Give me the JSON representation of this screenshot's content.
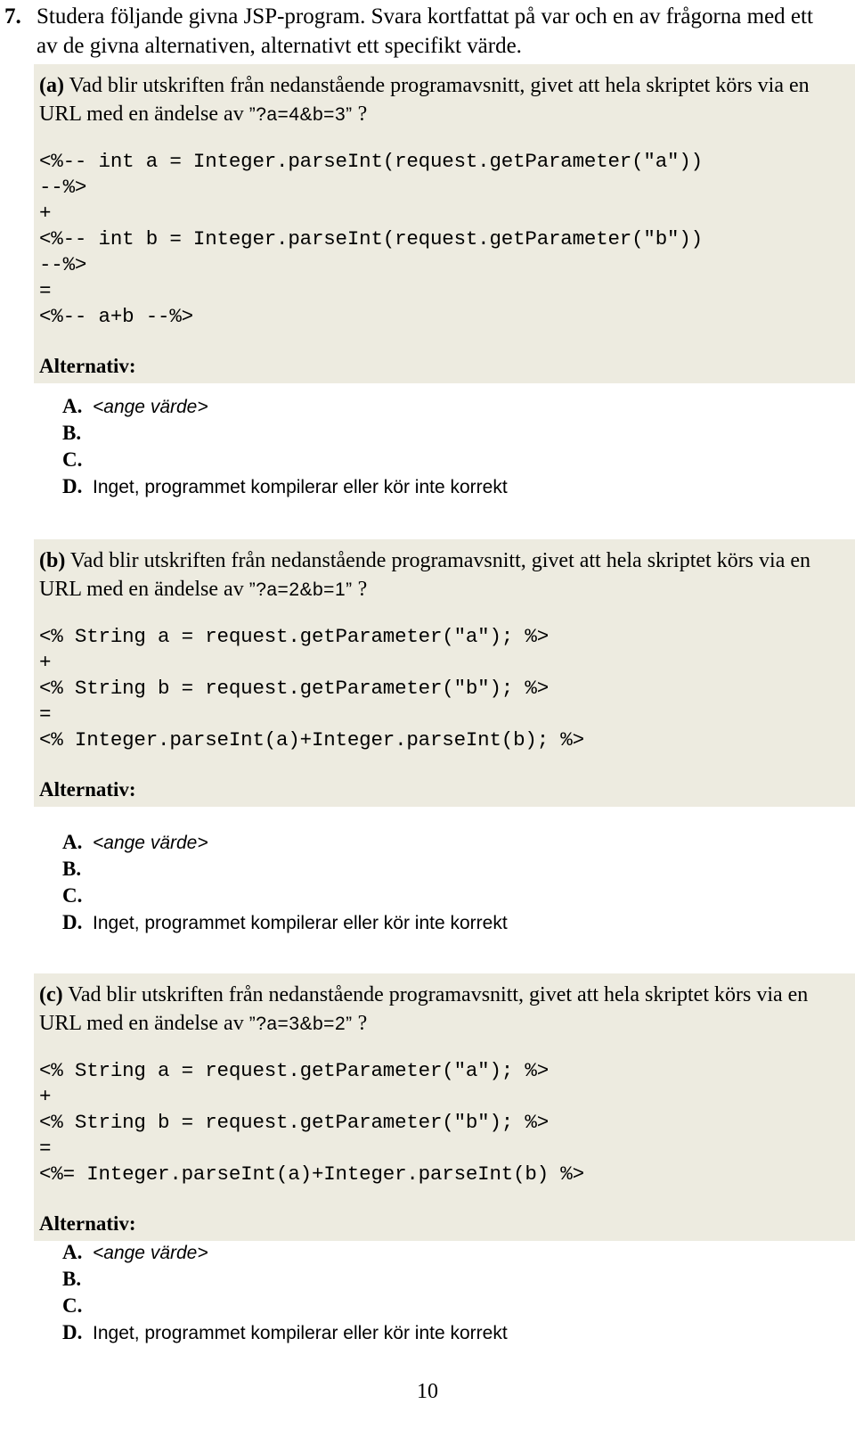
{
  "question": {
    "number": "7.",
    "text": "Studera följande givna JSP-program. Svara kortfattat på var och en av frågorna med ett av de givna alternativen, alternativt ett specifikt värde."
  },
  "alternatives_heading": "Alternativ:",
  "alternatives": {
    "a_key": "A.",
    "a_value": "<ange värde>",
    "b_key": "B.",
    "b_value": "",
    "c_key": "C.",
    "c_value": "",
    "d_key": "D.",
    "d_value": "Inget, programmet kompilerar eller kör inte korrekt"
  },
  "parts": {
    "a": {
      "label": "(a)",
      "prompt_line1": " Vad blir utskriften från nedanstående programavsnitt, givet att hela skriptet körs via en URL med en ändelse av ",
      "url_suffix": "”?a=4&b=3”",
      "prompt_tail": " ?",
      "code": "<%-- int a = Integer.parseInt(request.getParameter(\"a\"))\n--%>\n+\n<%-- int b = Integer.parseInt(request.getParameter(\"b\"))\n--%>\n=\n<%-- a+b --%>"
    },
    "b": {
      "label": "(b)",
      "prompt_line1": " Vad blir utskriften från nedanstående programavsnitt, givet att hela skriptet körs via en URL med en ändelse av ",
      "url_suffix": "”?a=2&b=1”",
      "prompt_tail": " ?",
      "code": "<% String a = request.getParameter(\"a\"); %>\n+\n<% String b = request.getParameter(\"b\"); %>\n=\n<% Integer.parseInt(a)+Integer.parseInt(b); %>"
    },
    "c": {
      "label": "(c)",
      "prompt_line1": " Vad blir utskriften från nedanstående programavsnitt, givet att hela skriptet körs via en URL med en ändelse av ",
      "url_suffix": "”?a=3&b=2”",
      "prompt_tail": " ?",
      "code": "<% String a = request.getParameter(\"a\"); %>\n+\n<% String b = request.getParameter(\"b\"); %>\n=\n<%= Integer.parseInt(a)+Integer.parseInt(b) %>"
    }
  },
  "footer": {
    "page_number": "10"
  },
  "colors": {
    "shaded_block": "#EDEBE0",
    "page_background": "#FFFFFF",
    "text": "#000000"
  }
}
